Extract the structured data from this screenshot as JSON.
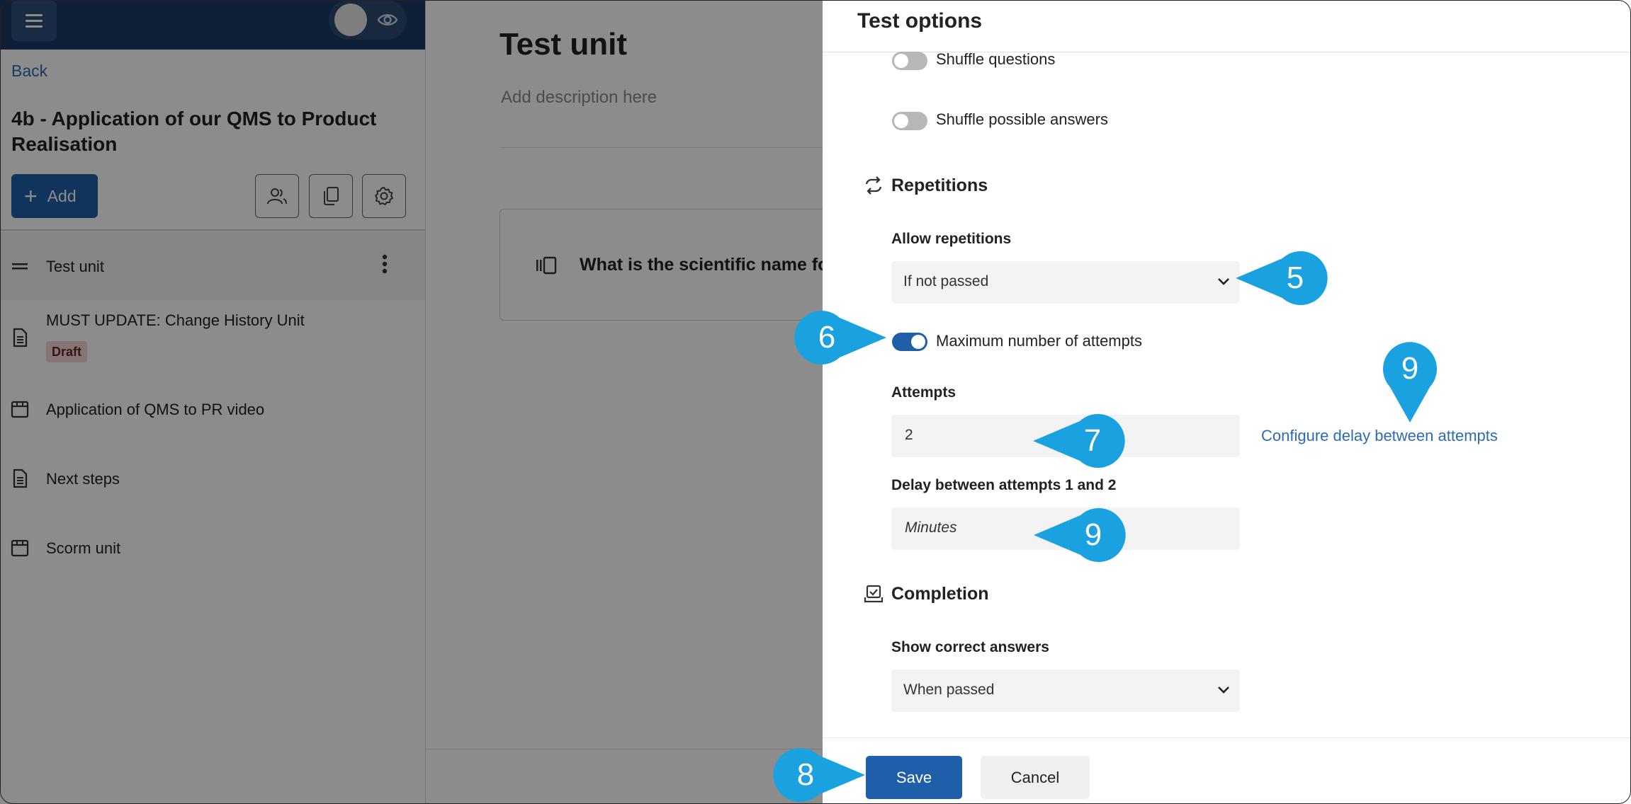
{
  "sidebar": {
    "back": "Back",
    "course_title": "4b - Application of our QMS to Product Realisation",
    "add_label": "Add",
    "items": [
      {
        "label": "Test unit",
        "icon": "drag-handle-icon"
      },
      {
        "label": "MUST UPDATE: Change History Unit",
        "icon": "document-icon",
        "badge": "Draft"
      },
      {
        "label": "Application of QMS to PR video",
        "icon": "media-box-icon"
      },
      {
        "label": "Next steps",
        "icon": "document-icon"
      },
      {
        "label": "Scorm unit",
        "icon": "media-box-icon"
      }
    ]
  },
  "main": {
    "title": "Test unit",
    "description_placeholder": "Add description here",
    "question_text": "What is the scientific name fo"
  },
  "drawer": {
    "title": "Test options",
    "shuffle_questions": {
      "label": "Shuffle questions",
      "on": false
    },
    "shuffle_answers": {
      "label": "Shuffle possible answers",
      "on": false
    },
    "repetitions": {
      "title": "Repetitions",
      "allow_label": "Allow repetitions",
      "allow_value": "If not passed",
      "max_attempts": {
        "label": "Maximum number of attempts",
        "on": true
      },
      "attempts_label": "Attempts",
      "attempts_value": "2",
      "configure_link": "Configure delay between attempts",
      "delay_label": "Delay between attempts 1 and 2",
      "delay_placeholder": "Minutes"
    },
    "completion": {
      "title": "Completion",
      "show_answers_label": "Show correct answers",
      "show_answers_value": "When passed"
    },
    "save": "Save",
    "cancel": "Cancel"
  },
  "callouts": [
    "5",
    "6",
    "7",
    "8",
    "9",
    "9"
  ],
  "colors": {
    "primary": "#1f5fa9",
    "topbar": "#1c3a66",
    "callout": "#1aa1e0",
    "link": "#2d6cb5",
    "draft_badge": "#f6d6d6"
  }
}
